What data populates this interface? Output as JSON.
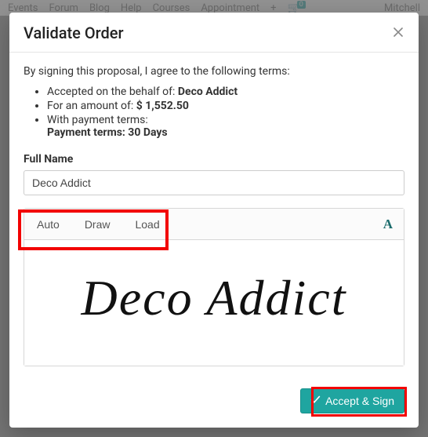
{
  "bg": {
    "nav": [
      "Events",
      "Forum",
      "Blog",
      "Help",
      "Courses",
      "Appointment"
    ],
    "plus": "+",
    "cart_count": "0",
    "user": "Mitchell"
  },
  "modal": {
    "title": "Validate Order",
    "intro": "By signing this proposal, I agree to the following terms:",
    "terms": {
      "accepted_prefix": "Accepted on the behalf of: ",
      "accepted_name": "Deco Addict",
      "amount_prefix": "For an amount of: ",
      "amount_value": "$ 1,552.50",
      "payment_prefix": "With payment terms:",
      "payment_value": "Payment terms: 30 Days"
    },
    "full_name_label": "Full Name",
    "full_name_value": "Deco Addict",
    "sig_tabs": {
      "auto": "Auto",
      "draw": "Draw",
      "load": "Load"
    },
    "font_glyph": "A",
    "signature_text": "Deco Addict",
    "accept_label": "Accept & Sign"
  }
}
